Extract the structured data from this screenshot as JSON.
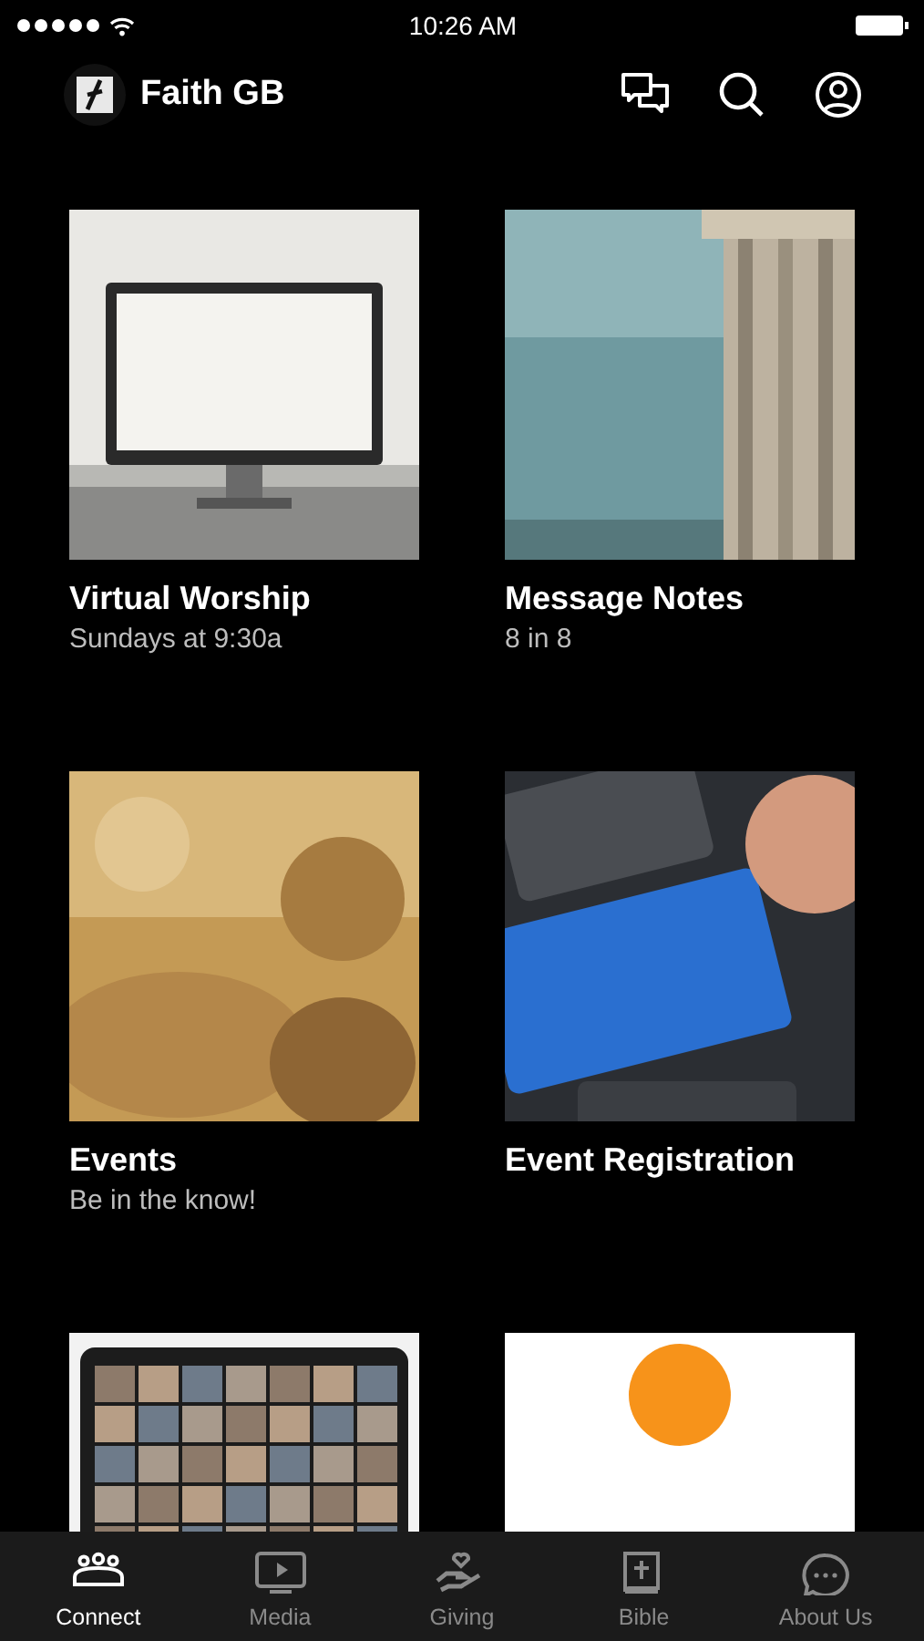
{
  "status_bar": {
    "time": "10:26 AM"
  },
  "header": {
    "title": "Faith GB"
  },
  "cards": [
    {
      "kind": "picture",
      "title": "Virtual Worship",
      "subtitle": "Sundays at 9:30a"
    },
    {
      "kind": "picture",
      "title": "Message Notes",
      "subtitle": "8 in 8"
    },
    {
      "kind": "picture",
      "title": "Events",
      "subtitle": "Be in the know!"
    },
    {
      "kind": "picture",
      "title": "Event Registration"
    },
    {
      "kind": "picture"
    },
    {
      "kind": "picture"
    }
  ],
  "tabs": [
    {
      "label": "Connect",
      "selected": true
    },
    {
      "label": "Media",
      "selected": false
    },
    {
      "label": "Giving",
      "selected": false
    },
    {
      "label": "Bible",
      "selected": false
    },
    {
      "label": "About Us",
      "selected": false
    }
  ]
}
